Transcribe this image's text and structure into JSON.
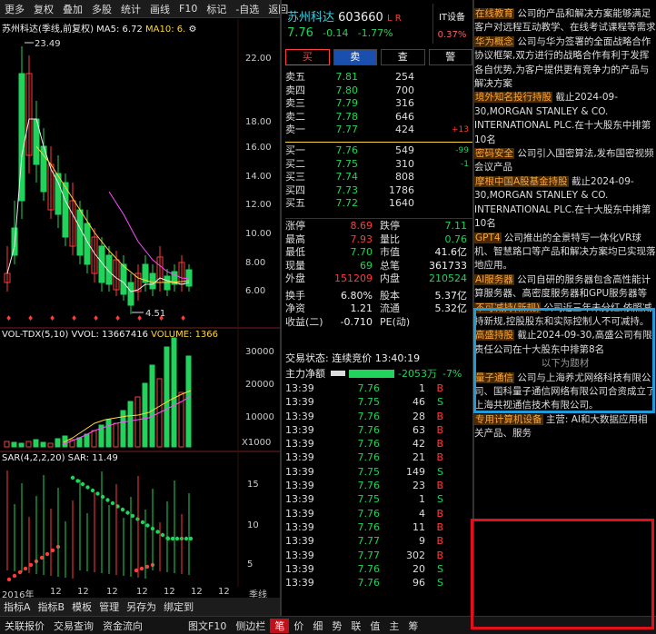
{
  "toolbar": {
    "items": [
      "更多",
      "复权",
      "叠加",
      "多股",
      "统计",
      "画线",
      "F10",
      "标记",
      "-自选",
      "返回"
    ]
  },
  "chart_legend": {
    "name": "苏州科达(季线,前复权)",
    "ma5": "MA5: 6.72",
    "ma10": "MA10: 6.",
    "high_marker": "23.49",
    "low_marker": "4.51"
  },
  "price_axis": [
    "22.00",
    "18.00",
    "16.00",
    "14.00",
    "12.00",
    "10.00",
    "8.00",
    "6.00"
  ],
  "vol_legend": {
    "name": "VOL-TDX(5,10)",
    "vvol": "VVOL: 13667416",
    "volume": "VOLUME: 1366"
  },
  "vol_axis": [
    "30000",
    "20000",
    "10000",
    "X1000"
  ],
  "sar_legend": {
    "name": "SAR(4,2,2,20)",
    "value": "SAR: 11.49"
  },
  "sar_axis": [
    "15",
    "10",
    "5"
  ],
  "x_axis": [
    "2016年",
    "12",
    "12",
    "12",
    "12",
    "12",
    "12",
    "12",
    "季线"
  ],
  "bottom_tabs": [
    "指标A",
    "指标B",
    "模板",
    "管理",
    "另存为",
    "绑定到"
  ],
  "status_bar": [
    "关联报价",
    "交易查询",
    "资金流向",
    "图文F10",
    "侧边栏",
    "笔",
    "价",
    "细",
    "势",
    "联",
    "值",
    "主",
    "筹"
  ],
  "quote": {
    "name": "苏州科达",
    "code": "603660",
    "flags": "L R",
    "price": "7.76",
    "change": "-0.14",
    "pct": "-1.77%",
    "sector": "IT设备",
    "sector_pct": "0.37%"
  },
  "buttons": [
    "买",
    "卖",
    "查",
    "警"
  ],
  "asks": [
    {
      "label": "卖五",
      "price": "7.81",
      "vol": "254",
      "chg": ""
    },
    {
      "label": "卖四",
      "price": "7.80",
      "vol": "700",
      "chg": ""
    },
    {
      "label": "卖三",
      "price": "7.79",
      "vol": "316",
      "chg": ""
    },
    {
      "label": "卖二",
      "price": "7.78",
      "vol": "646",
      "chg": ""
    },
    {
      "label": "卖一",
      "price": "7.77",
      "vol": "424",
      "chg": "+13"
    }
  ],
  "bids": [
    {
      "label": "买一",
      "price": "7.76",
      "vol": "549",
      "chg": "-99"
    },
    {
      "label": "买二",
      "price": "7.75",
      "vol": "310",
      "chg": "-1"
    },
    {
      "label": "买三",
      "price": "7.74",
      "vol": "808",
      "chg": ""
    },
    {
      "label": "买四",
      "price": "7.73",
      "vol": "1786",
      "chg": ""
    },
    {
      "label": "买五",
      "price": "7.72",
      "vol": "1640",
      "chg": ""
    }
  ],
  "stats": [
    {
      "k1": "涨停",
      "v1": "8.69",
      "c1": "red",
      "k2": "跌停",
      "v2": "7.11",
      "c2": "green"
    },
    {
      "k1": "最高",
      "v1": "7.93",
      "c1": "red",
      "k2": "量比",
      "v2": "0.76",
      "c2": "green"
    },
    {
      "k1": "最低",
      "v1": "7.70",
      "c1": "green",
      "k2": "市值",
      "v2": "41.6亿",
      "c2": "white"
    },
    {
      "k1": "现量",
      "v1": "69",
      "c1": "green",
      "k2": "总笔",
      "v2": "361733",
      "c2": "white"
    },
    {
      "k1": "外盘",
      "v1": "151209",
      "c1": "red",
      "k2": "内盘",
      "v2": "210524",
      "c2": "green"
    },
    {
      "k1": "换手",
      "v1": "6.80%",
      "c1": "white",
      "k2": "股本",
      "v2": "5.37亿",
      "c2": "white"
    },
    {
      "k1": "净资",
      "v1": "1.21",
      "c1": "white",
      "k2": "流通",
      "v2": "5.32亿",
      "c2": "white"
    },
    {
      "k1": "收益(二)",
      "v1": "-0.710",
      "c1": "white",
      "k2": "PE(动)",
      "v2": "",
      "c2": "white"
    }
  ],
  "trade_status": "交易状态: 连续竞价  13:40:19",
  "main_flow": {
    "label": "主力净额",
    "value": "-2053万",
    "pct": "-7%"
  },
  "trades": [
    {
      "t": "13:39",
      "p": "7.76",
      "v": "1",
      "s": "B"
    },
    {
      "t": "13:39",
      "p": "7.75",
      "v": "46",
      "s": "S"
    },
    {
      "t": "13:39",
      "p": "7.76",
      "v": "28",
      "s": "B"
    },
    {
      "t": "13:39",
      "p": "7.76",
      "v": "63",
      "s": "B"
    },
    {
      "t": "13:39",
      "p": "7.76",
      "v": "42",
      "s": "B"
    },
    {
      "t": "13:39",
      "p": "7.76",
      "v": "21",
      "s": "B"
    },
    {
      "t": "13:39",
      "p": "7.75",
      "v": "149",
      "s": "S"
    },
    {
      "t": "13:39",
      "p": "7.76",
      "v": "23",
      "s": "B"
    },
    {
      "t": "13:39",
      "p": "7.75",
      "v": "1",
      "s": "S"
    },
    {
      "t": "13:39",
      "p": "7.76",
      "v": "4",
      "s": "B"
    },
    {
      "t": "13:39",
      "p": "7.76",
      "v": "11",
      "s": "B"
    },
    {
      "t": "13:39",
      "p": "7.77",
      "v": "9",
      "s": "B"
    },
    {
      "t": "13:39",
      "p": "7.77",
      "v": "302",
      "s": "B"
    },
    {
      "t": "13:39",
      "p": "7.76",
      "v": "20",
      "s": "S"
    },
    {
      "t": "13:39",
      "p": "7.76",
      "v": "96",
      "s": "S"
    }
  ],
  "news": [
    {
      "tag": "在线教育",
      "text": "公司的产品和解决方案能够满足客户对远程互动教学、在线考试课程等需求"
    },
    {
      "tag": "华为概念",
      "text": "公司与华为签署的全面战略合作协议框架,双方进行的战略合作有利于发挥各自优势,为客户提供更有竞争力的产品与解决方案"
    },
    {
      "tag": "境外知名投行持股",
      "text": "截止2024-09-30,MORGAN STANLEY & CO. INTERNATIONAL PLC.在十大股东中排第10名"
    },
    {
      "tag": "密码安全",
      "text": "公司引入国密算法,发布国密视频会议产品"
    },
    {
      "tag": "摩根中国A股基金持股",
      "text": "截止2024-09-30,MORGAN STANLEY & CO. INTERNATIONAL PLC.在十大股东中排第10名"
    },
    {
      "tag": "GPT4",
      "text": "公司推出的全景特写一体化VR球机、智慧路口等产品和解决方案均已实现落地应用。"
    },
    {
      "tag": "AI服务器",
      "text": "公司自研的服务器包含高性能计算服务器、高密度服务器和GPU服务器等"
    },
    {
      "tag": "不可减持(新规)",
      "text": "公司近三年未分红,依照减持新规,控股股东和实际控制人不可减持。"
    },
    {
      "tag": "高盛持股",
      "text": "截止2024-09-30,高盛公司有限责任公司在十大股东中排第8名"
    },
    {
      "tag": "",
      "text": "以下为题材"
    },
    {
      "tag": "量子通信",
      "text": "公司与上海养尤网络科技有限公司、国科量子通信网络有限公司合资成立了上海共视通信技术有限公司。"
    },
    {
      "tag": "专用计算机设备",
      "text": "主营: AI和大数据应用相关产品、服务"
    }
  ],
  "colors": {
    "up": "#ff3b3b",
    "down": "#1fd35b",
    "box_blue": "#1e9bd8",
    "box_red": "#e0101c",
    "ma5": "#ffffff",
    "ma10": "#ffd83a"
  }
}
